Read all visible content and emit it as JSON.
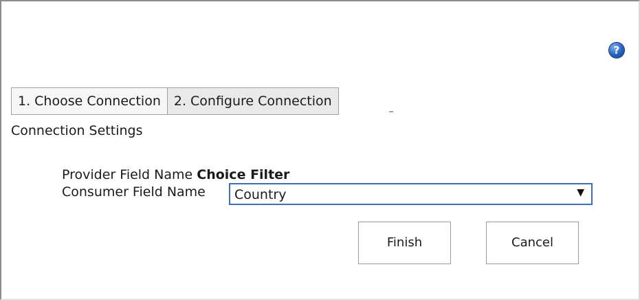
{
  "help": {
    "icon": "help-icon",
    "label": "?"
  },
  "tabs": [
    {
      "label": "1. Choose Connection"
    },
    {
      "label": "2. Configure Connection"
    }
  ],
  "section_title": "Connection Settings",
  "provider": {
    "label": "Provider Field Name",
    "value": "Choice Filter"
  },
  "consumer": {
    "label": "Consumer Field Name",
    "selected": "Country",
    "arrow": "▼"
  },
  "buttons": {
    "finish": "Finish",
    "cancel": "Cancel"
  }
}
